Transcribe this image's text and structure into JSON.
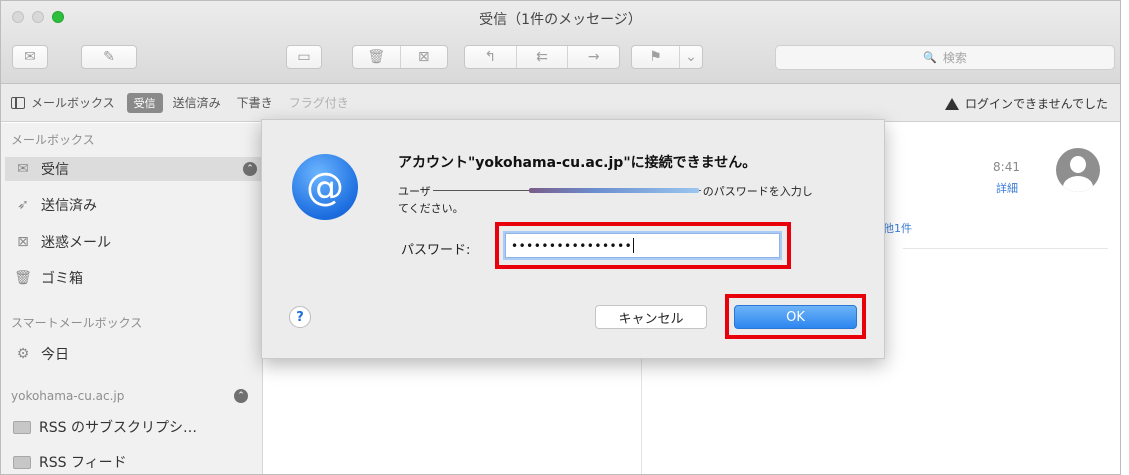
{
  "window": {
    "title": "受信（1件のメッセージ）"
  },
  "toolbar": {
    "search_placeholder": "検索",
    "icons": [
      "envelope-icon",
      "compose-icon",
      "archive-icon",
      "trash-icon",
      "junk-icon",
      "reply-icon",
      "reply-all-icon",
      "forward-icon",
      "flag-icon",
      "chevron-down-icon",
      "search-icon"
    ]
  },
  "favorites": {
    "mailboxes_label": "メールボックス",
    "inbox_label": "受信",
    "sent_label": "送信済み",
    "drafts_label": "下書き",
    "flagged_label": "フラグ付き",
    "warning_text": "ログインできませんでした"
  },
  "sidebar": {
    "section_mailboxes": "メールボックス",
    "items": [
      {
        "label": "受信"
      },
      {
        "label": "送信済み"
      },
      {
        "label": "迷惑メール"
      },
      {
        "label": "ゴミ箱"
      }
    ],
    "section_smart": "スマートメールボックス",
    "smart_items": [
      {
        "label": "今日"
      }
    ],
    "account_name": "yokohama-cu.ac.jp",
    "account_items": [
      {
        "label": "RSS のサブスクリプシ…"
      },
      {
        "label": "RSS フィード"
      }
    ]
  },
  "preview": {
    "time": "8:41",
    "details": "詳細",
    "count_fragment": "他1件"
  },
  "dialog": {
    "title": "アカウント\"yokohama-cu.ac.jp\"に接続できません。",
    "message_prefix": "ユーザ",
    "message_suffix": "のパスワードを入力し",
    "message_line2": "てください。",
    "password_label": "パスワード:",
    "password_value": "••••••••••••••••",
    "help_label": "?",
    "cancel_label": "キャンセル",
    "ok_label": "OK"
  },
  "colors": {
    "highlight": "#e8000b",
    "ok_button": "#2d86ef",
    "at_icon": "#1d6ee0"
  }
}
